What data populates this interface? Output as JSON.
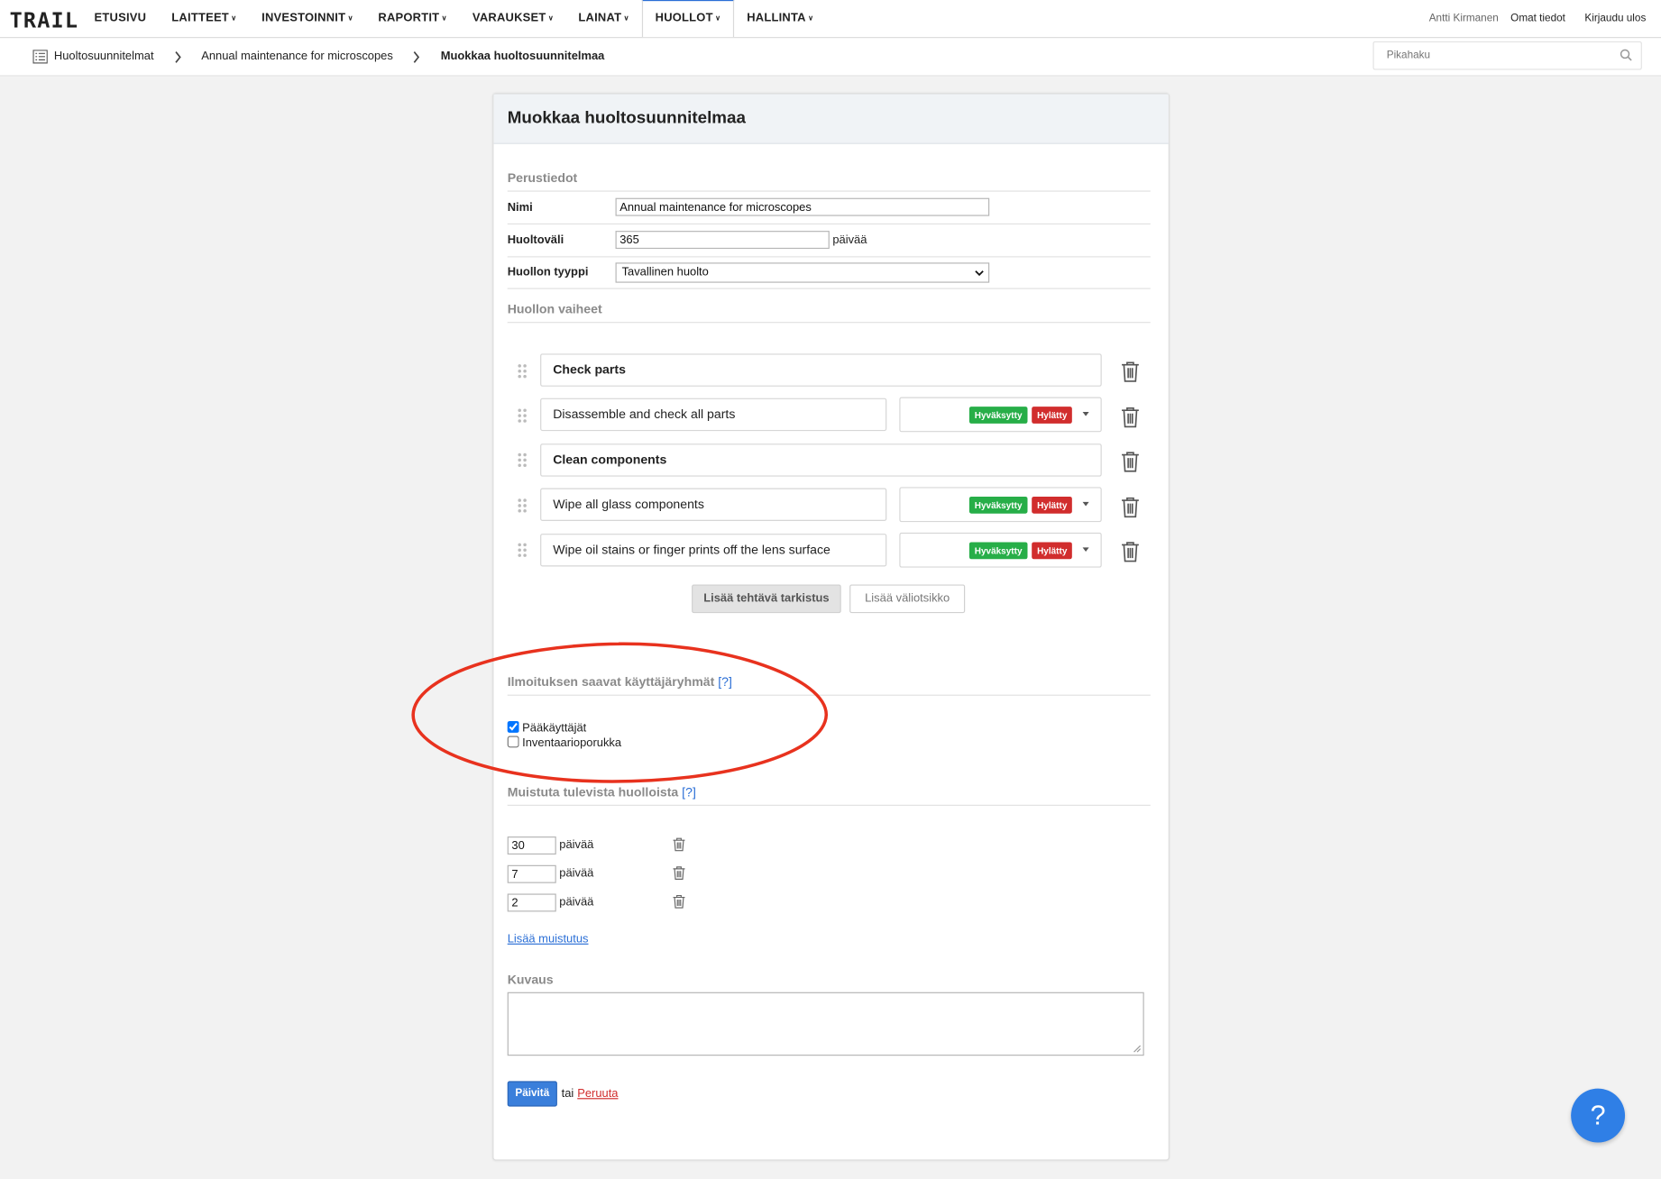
{
  "nav": {
    "logo": "TRAIL",
    "items": [
      {
        "label": "ETUSIVU"
      },
      {
        "label": "LAITTEET"
      },
      {
        "label": "INVESTOINNIT"
      },
      {
        "label": "RAPORTIT"
      },
      {
        "label": "VARAUKSET"
      },
      {
        "label": "LAINAT"
      },
      {
        "label": "HUOLLOT"
      },
      {
        "label": "HALLINTA"
      }
    ],
    "user": "Antti Kirmanen",
    "profile": "Omat tiedot",
    "logout": "Kirjaudu ulos"
  },
  "breadcrumb": {
    "items": [
      "Huoltosuunnitelmat",
      "Annual maintenance for microscopes",
      "Muokkaa huoltosuunnitelmaa"
    ]
  },
  "search": {
    "placeholder": "Pikahaku"
  },
  "form": {
    "title": "Muokkaa huoltosuunnitelmaa",
    "basic_section": "Perustiedot",
    "name_label": "Nimi",
    "name_value": "Annual maintenance for microscopes",
    "interval_label": "Huoltoväli",
    "interval_value": "365",
    "interval_unit": "päivää",
    "type_label": "Huollon tyyppi",
    "type_value": "Tavallinen huolto",
    "phases_section": "Huollon vaiheet",
    "phases": [
      {
        "text": "Check parts",
        "kind": "header"
      },
      {
        "text": "Disassemble and check all parts",
        "kind": "task"
      },
      {
        "text": "Clean components",
        "kind": "header"
      },
      {
        "text": "Wipe all glass components",
        "kind": "task"
      },
      {
        "text": "Wipe oil stains or finger prints off the lens surface",
        "kind": "task"
      }
    ],
    "approved_label": "Hyväksytty",
    "rejected_label": "Hylätty",
    "add_task_button": "Lisää tehtävä tarkistus",
    "add_subheading_button": "Lisää väliotsikko",
    "notify_section": "Ilmoituksen saavat käyttäjäryhmät",
    "help_marker": "[?]",
    "groups": [
      {
        "label": "Pääkäyttäjät",
        "checked": true
      },
      {
        "label": "Inventaarioporukka",
        "checked": false
      }
    ],
    "remind_section": "Muistuta tulevista huolloista",
    "reminders": [
      {
        "value": "30",
        "unit": "päivää"
      },
      {
        "value": "7",
        "unit": "päivää"
      },
      {
        "value": "2",
        "unit": "päivää"
      }
    ],
    "add_reminder": "Lisää muistutus",
    "desc_section": "Kuvaus",
    "description": "",
    "update_button": "Päivitä",
    "or_text": "tai",
    "cancel_link": "Peruuta"
  },
  "help_button": "?",
  "colors": {
    "accent": "#2b6fd6",
    "approved": "#27ae48",
    "rejected": "#d12d2d",
    "annotation": "#e8321e",
    "help_fab": "#2f7fe6"
  }
}
